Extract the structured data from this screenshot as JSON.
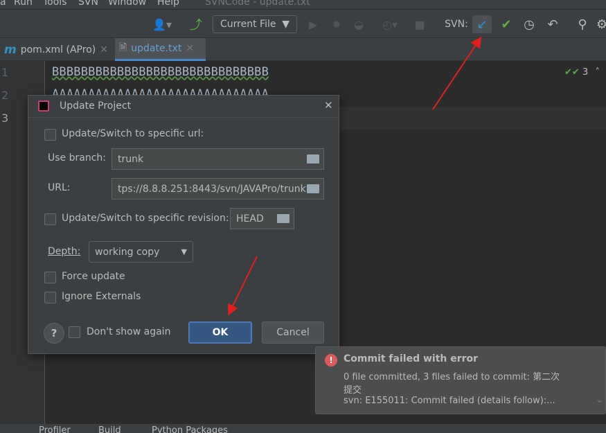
{
  "menu": [
    "Run",
    "Tools",
    "SVN",
    "Window",
    "Help"
  ],
  "window_title": "SVNCode - update.txt",
  "toolbar": {
    "run_config": "Current File",
    "svn_label": "SVN:"
  },
  "tabs": [
    {
      "label": "pom.xml (APro)",
      "active": false
    },
    {
      "label": "update.txt",
      "active": true
    }
  ],
  "editor": {
    "line_numbers": [
      "1",
      "2",
      "3"
    ],
    "lines": [
      "BBBBBBBBBBBBBBBBBBBBBBBBBBBBBB",
      "AAAAAAAAAAAAAAAAAAAAAAAAAAAAAA"
    ],
    "inspection_count": "3"
  },
  "dialog": {
    "title": "Update Project",
    "specific_url_label": "Update/Switch to specific url:",
    "use_branch_label": "Use branch:",
    "use_branch_value": "trunk",
    "url_label": "URL:",
    "url_value": "tps://8.8.8.251:8443/svn/JAVAPro/trunk",
    "specific_revision_label": "Update/Switch to specific revision:",
    "revision_value": "HEAD",
    "depth_label": "Depth:",
    "depth_value": "working copy",
    "force_update_label": "Force update",
    "ignore_externals_label": "Ignore Externals",
    "help": "?",
    "dont_show_label": "Don't show again",
    "ok": "OK",
    "cancel": "Cancel"
  },
  "notification": {
    "title": "Commit failed with error",
    "line1": "0 file committed, 3 files failed to commit: 第二次",
    "line2": "提交",
    "line3": "svn: E155011: Commit failed (details follow):..."
  },
  "statusbar": [
    "Profiler",
    "Build",
    "Python Packages"
  ],
  "colors": {
    "accent": "#3592c4",
    "annotation_arrow": "#e02020",
    "error": "#db5c5c"
  }
}
